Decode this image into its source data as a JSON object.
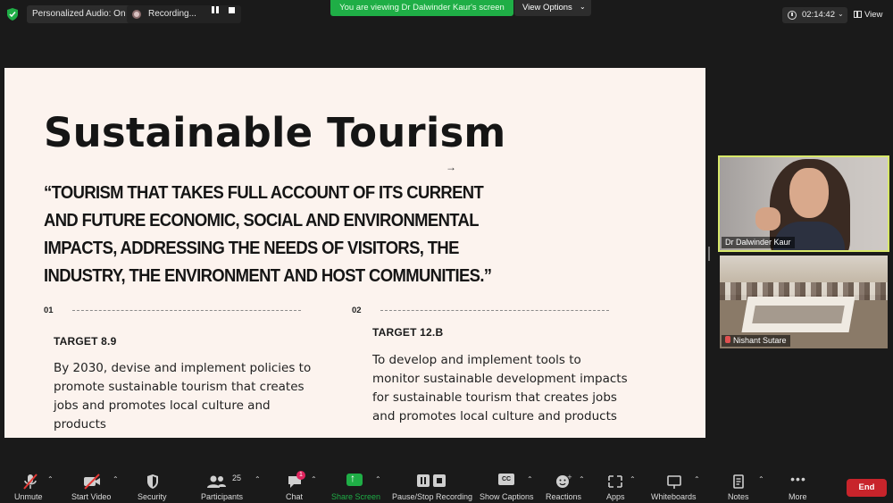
{
  "top_bar": {
    "audio_label": "Personalized Audio: On",
    "recording_label": "Recording...",
    "viewing_banner": "You are viewing Dr Dalwinder Kaur's screen",
    "view_options_label": "View Options",
    "timer": "02:14:42",
    "view_label": "View"
  },
  "slide": {
    "title": "Sustainable Tourism",
    "quote": "“Tourism that takes full account of its current and future economic, social and environmental impacts, addressing the needs of visitors, the industry, the environment and host communities.”",
    "columns": [
      {
        "number": "01",
        "target_title": "TARGET 8.9",
        "text": "By 2030, devise and implement policies to promote sustainable tourism that creates jobs and promotes local culture and products"
      },
      {
        "number": "02",
        "target_title": "TARGET 12.B",
        "text": "To develop and implement tools to monitor sustainable development impacts for sustainable tourism that creates jobs and promotes local culture and products"
      }
    ]
  },
  "participants_video": [
    {
      "name": "Dr Dalwinder Kaur"
    },
    {
      "name": "Nishant Sutare"
    }
  ],
  "toolbar": {
    "items": [
      {
        "label": "Unmute",
        "icon": "muted-mic-icon"
      },
      {
        "label": "Start Video",
        "icon": "video-off-icon"
      },
      {
        "label": "Security",
        "icon": "shield-icon"
      },
      {
        "label": "Participants",
        "icon": "participants-icon",
        "count": "25"
      },
      {
        "label": "Chat",
        "icon": "chat-icon",
        "badge": "1"
      },
      {
        "label": "Share Screen",
        "icon": "share-screen-icon"
      },
      {
        "label": "Pause/Stop Recording",
        "icon": "recording-control-icon"
      },
      {
        "label": "Show Captions",
        "icon": "captions-icon"
      },
      {
        "label": "Reactions",
        "icon": "reactions-icon"
      },
      {
        "label": "Apps",
        "icon": "apps-icon"
      },
      {
        "label": "Whiteboards",
        "icon": "whiteboard-icon"
      },
      {
        "label": "Notes",
        "icon": "notes-icon"
      },
      {
        "label": "More",
        "icon": "more-icon"
      }
    ],
    "end_label": "End",
    "captions_glyph": "CC"
  },
  "colors": {
    "accent_green": "#1fae46",
    "end_red": "#c8242b",
    "slide_bg": "#fcf3ee",
    "speaker_border": "#d8e86a"
  }
}
